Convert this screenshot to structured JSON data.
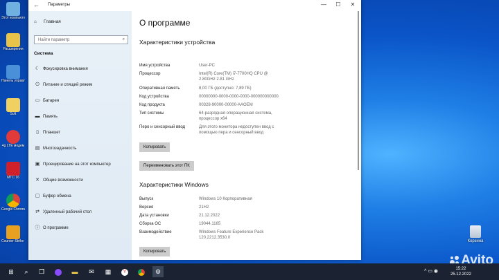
{
  "window": {
    "title": "Параметры",
    "back_icon": "←",
    "minimize": "—",
    "maximize": "☐",
    "close": "✕"
  },
  "sidebar": {
    "home_label": "Главная",
    "search_placeholder": "Найти параметр",
    "section_title": "Система",
    "items": [
      {
        "label": "Фокусировка внимания",
        "icon": "moon-icon",
        "glyph": "☾"
      },
      {
        "label": "Питание и спящий режим",
        "icon": "power-icon",
        "glyph": "⏻"
      },
      {
        "label": "Батарея",
        "icon": "battery-icon",
        "glyph": "▭"
      },
      {
        "label": "Память",
        "icon": "storage-icon",
        "glyph": "▬"
      },
      {
        "label": "Планшет",
        "icon": "tablet-icon",
        "glyph": "▯"
      },
      {
        "label": "Многозадачность",
        "icon": "multitasking-icon",
        "glyph": "▤"
      },
      {
        "label": "Проецирование на этот компьютер",
        "icon": "projecting-icon",
        "glyph": "▣"
      },
      {
        "label": "Общие возможности",
        "icon": "shared-experiences-icon",
        "glyph": "✕"
      },
      {
        "label": "Буфер обмена",
        "icon": "clipboard-icon",
        "glyph": "▢"
      },
      {
        "label": "Удаленный рабочий стол",
        "icon": "remote-desktop-icon",
        "glyph": "⇄"
      },
      {
        "label": "О программе",
        "icon": "info-icon",
        "glyph": "ⓘ"
      }
    ]
  },
  "main": {
    "page_title": "О программе",
    "device_section_title": "Характеристики устройства",
    "device_specs": [
      {
        "key": "Имя устройства",
        "value": "User-PC"
      },
      {
        "key": "Процессор",
        "value": "Intel(R) Core(TM) i7-7700HQ CPU @ 2.80GHz   2.81 GHz"
      },
      {
        "key": "Оперативная память",
        "value": "8,00 ГБ (доступно: 7,89 ГБ)"
      },
      {
        "key": "Код устройства",
        "value": "00000000-0000-0000-0000-000000000000"
      },
      {
        "key": "Код продукта",
        "value": "00328-90000-00000-AAOEM"
      },
      {
        "key": "Тип системы",
        "value": "64-разрядная операционная система, процессор x64"
      },
      {
        "key": "Перо и сенсорный ввод",
        "value": "Для этого монитора недоступен ввод с помощью пера и сенсорный ввод"
      }
    ],
    "copy_button": "Копировать",
    "rename_button": "Переименовать этот ПК",
    "windows_section_title": "Характеристики Windows",
    "windows_specs": [
      {
        "key": "Выпуск",
        "value": "Windows 10 Корпоративная"
      },
      {
        "key": "Версия",
        "value": "21H2"
      },
      {
        "key": "Дата установки",
        "value": "21.12.2022"
      },
      {
        "key": "Сборка ОС",
        "value": "19044.1165"
      },
      {
        "key": "Взаимодействие",
        "value": "Windows Feature Experience Pack 120.2212.3530.0"
      }
    ],
    "copy_button_2": "Копировать"
  },
  "desktop": {
    "icons": [
      {
        "label": "Этот компьютер",
        "color": "#6fb0e0"
      },
      {
        "label": "Расширения",
        "color": "#e8c34a"
      },
      {
        "label": "Панель управления",
        "color": "#4a90d9"
      },
      {
        "label": "Soft",
        "color": "#f0d060"
      },
      {
        "label": "4g LTE модем",
        "color": "#e03a3a"
      },
      {
        "label": "МТС 16",
        "color": "#d0202a"
      },
      {
        "label": "Google Chrome",
        "color": "#e9b320"
      },
      {
        "label": "Counter-Strike GO",
        "color": "#e7a020"
      }
    ],
    "recycle_bin": "Корзина"
  },
  "taskbar": {
    "time": "15:22",
    "date": "25.12.2022",
    "tray": "^ ▭ ◉"
  },
  "watermark": "Avito"
}
